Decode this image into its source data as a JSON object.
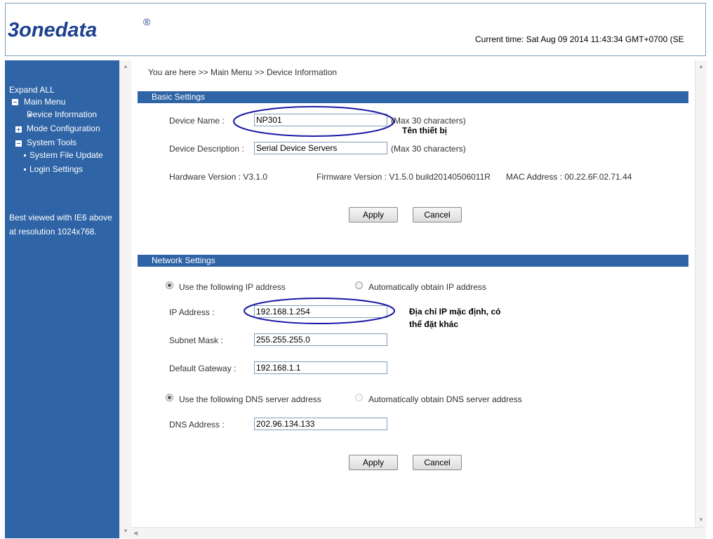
{
  "header": {
    "logo": "3onedata",
    "logo_mark": "®",
    "current_time": "Current time: Sat Aug 09 2014 11:43:34 GMT+0700 (SE"
  },
  "sidebar": {
    "expand_all": "Expand ALL",
    "items": [
      {
        "label": "Main Menu"
      },
      {
        "label": "Device Information"
      },
      {
        "label": "Mode Configuration"
      },
      {
        "label": "System Tools"
      },
      {
        "label": "System File Update"
      },
      {
        "label": "Login Settings"
      }
    ],
    "note_line1": "Best viewed with IE6 above",
    "note_line2": "at resolution 1024x768."
  },
  "breadcrumb": "You are here >> Main Menu >> Device Information",
  "basic": {
    "title": "Basic Settings",
    "device_name_label": "Device Name :",
    "device_name_value": "NP301",
    "device_name_hint": "(Max 30 characters)",
    "device_desc_label": "Device Description :",
    "device_desc_value": "Serial Device Servers",
    "device_desc_hint": "(Max 30 characters)",
    "hardware_version": "Hardware Version : V3.1.0",
    "firmware_version": "Firmware Version : V1.5.0 build20140506011R",
    "mac_address": "MAC Address : 00.22.6F.02.71.44",
    "apply_label": "Apply",
    "cancel_label": "Cancel"
  },
  "network": {
    "title": "Network Settings",
    "use_ip_label": "Use the following IP address",
    "auto_ip_label": "Automatically obtain IP address",
    "ip_label": "IP Address :",
    "ip_value": "192.168.1.254",
    "subnet_label": "Subnet Mask :",
    "subnet_value": "255.255.255.0",
    "gateway_label": "Default Gateway :",
    "gateway_value": "192.168.1.1",
    "use_dns_label": "Use the following DNS server address",
    "auto_dns_label": "Automatically obtain DNS server address",
    "dns_label": "DNS Address :",
    "dns_value": "202.96.134.133",
    "apply_label": "Apply",
    "cancel_label": "Cancel"
  },
  "annotations": {
    "device_name_note": "Tên thiết bị",
    "ip_note_line1": "Địa chỉ IP mặc định, có",
    "ip_note_line2": "thể đặt khác",
    "ink_color": "#1a1aa6"
  },
  "colors": {
    "brand_blue": "#2f64a6",
    "logo_blue": "#1d3f8f"
  }
}
